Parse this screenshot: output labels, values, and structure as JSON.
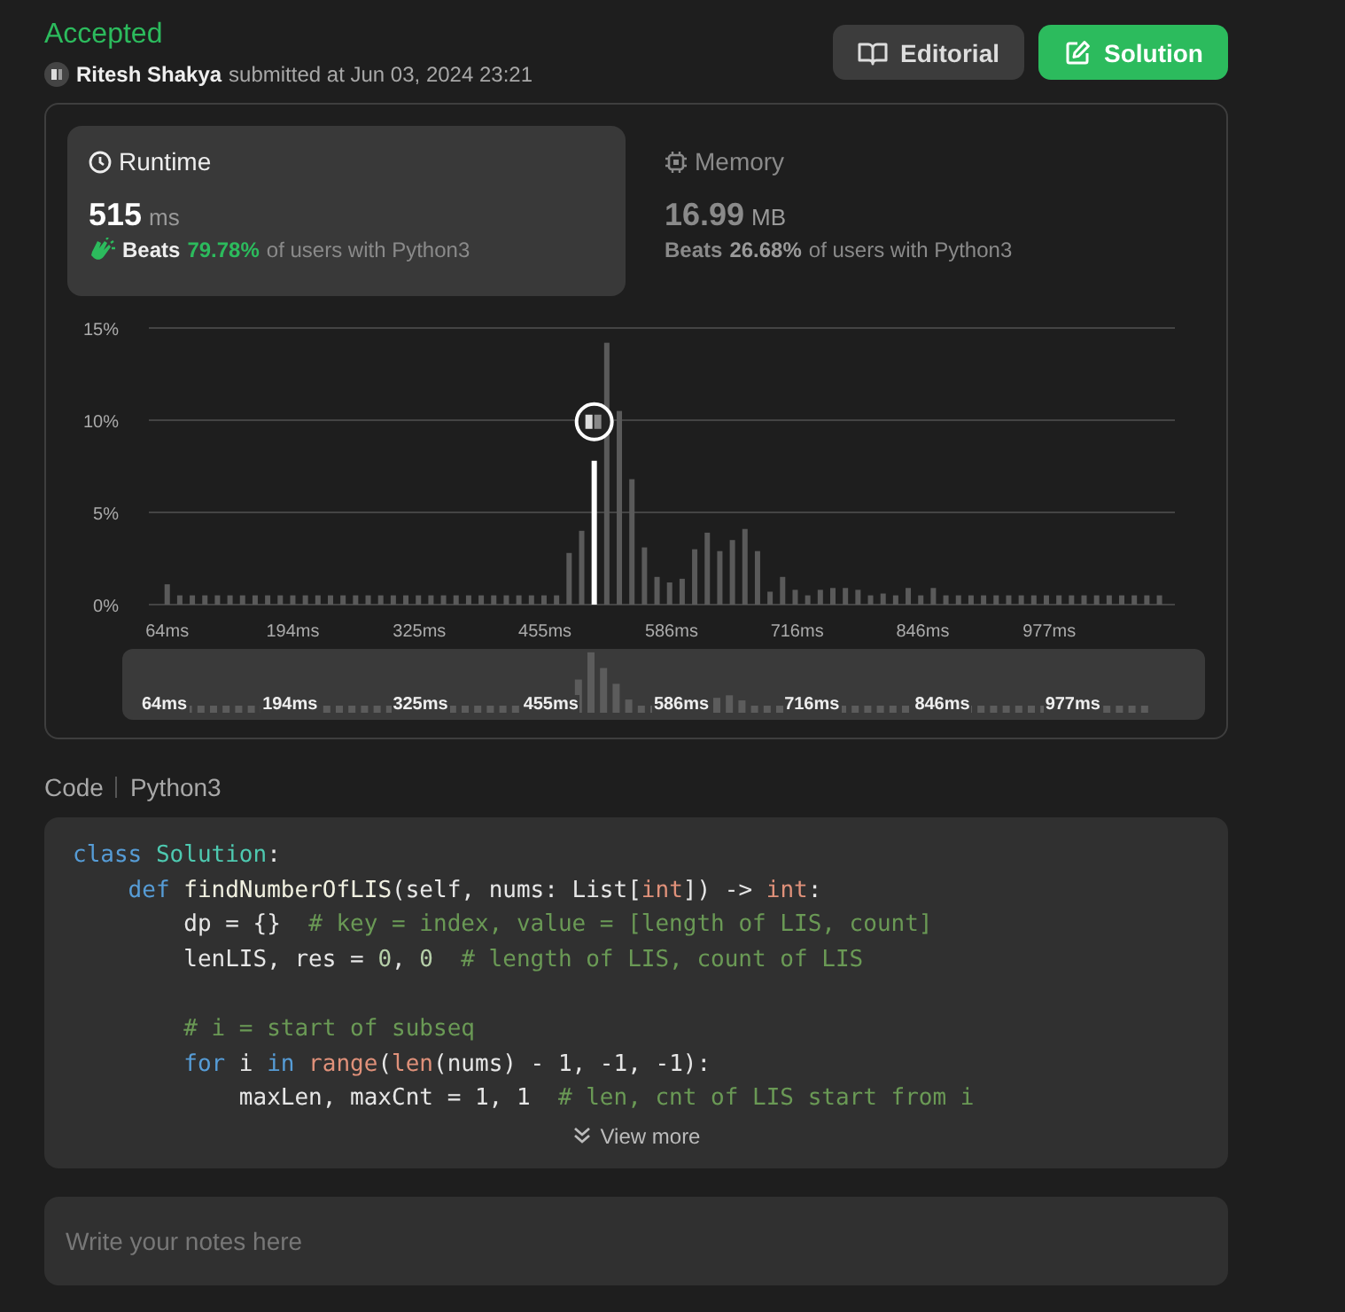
{
  "header": {
    "status": "Accepted",
    "user": "Ritesh Shakya",
    "submitted": "submitted at Jun 03, 2024 23:21"
  },
  "buttons": [
    {
      "label": "Editorial",
      "kind": "secondary"
    },
    {
      "label": "Solution",
      "kind": "primary"
    }
  ],
  "metrics": [
    {
      "label": "Runtime",
      "kind": "time",
      "value": "515",
      "unit": "ms",
      "beats": "Beats",
      "percent": "79.78%",
      "rest": "of users with Python3",
      "selected": true
    },
    {
      "label": "Memory",
      "kind": "memory",
      "value": "16.99",
      "unit": "MB",
      "beats": "Beats",
      "percent": "26.68%",
      "rest": "of users with Python3",
      "selected": false
    }
  ],
  "chart": {
    "chart_data": {
      "type": "bar",
      "stacked": true,
      "xlim": [
        45,
        1107
      ],
      "ylim": [
        0,
        15
      ],
      "yticks": [
        {
          "value": 0,
          "label": "0%"
        },
        {
          "value": 5,
          "label": "5%"
        },
        {
          "value": 10,
          "label": "10%"
        },
        {
          "value": 15,
          "label": "15%"
        }
      ],
      "xticks": [
        {
          "value": 64,
          "label": "64ms"
        },
        {
          "value": 194,
          "label": "194ms"
        },
        {
          "value": 325,
          "label": "325ms"
        },
        {
          "value": 455,
          "label": "455ms"
        },
        {
          "value": 586,
          "label": "586ms"
        },
        {
          "value": 716,
          "label": "716ms"
        },
        {
          "value": 846,
          "label": "846ms"
        },
        {
          "value": 977,
          "label": "977ms"
        }
      ],
      "x": [
        64,
        77,
        90,
        103,
        116,
        129,
        142,
        155,
        168,
        181,
        194,
        207,
        220,
        233,
        246,
        259,
        272,
        285,
        298,
        311,
        324,
        337,
        350,
        363,
        376,
        389,
        402,
        415,
        428,
        441,
        454,
        467,
        480,
        493,
        506,
        519,
        532,
        545,
        558,
        571,
        584,
        597,
        610,
        623,
        636,
        649,
        662,
        675,
        688,
        701,
        714,
        727,
        740,
        753,
        766,
        779,
        792,
        805,
        818,
        831,
        844,
        857,
        870,
        883,
        896,
        909,
        922,
        935,
        948,
        961,
        974,
        987,
        1000,
        1013,
        1026,
        1039,
        1052,
        1065,
        1078,
        1091
      ],
      "series": [
        {
          "color": "#5a5a5a",
          "values": [
            1.1,
            0.5,
            0.5,
            0.5,
            0.5,
            0.5,
            0.5,
            0.5,
            0.5,
            0.5,
            0.5,
            0.5,
            0.5,
            0.5,
            0.5,
            0.5,
            0.5,
            0.5,
            0.5,
            0.5,
            0.5,
            0.5,
            0.5,
            0.5,
            0.5,
            0.5,
            0.5,
            0.5,
            0.5,
            0.5,
            0.5,
            0.5,
            2.8,
            4.0,
            null,
            14.2,
            10.5,
            6.8,
            3.1,
            1.5,
            1.2,
            1.4,
            3.0,
            3.9,
            2.9,
            3.5,
            4.1,
            2.9,
            0.7,
            1.5,
            0.8,
            0.5,
            0.8,
            0.9,
            0.9,
            0.8,
            0.5,
            0.6,
            0.5,
            0.9,
            0.5,
            0.9,
            0.5,
            0.5,
            0.5,
            0.5,
            0.5,
            0.5,
            0.5,
            0.5,
            0.5,
            0.5,
            0.5,
            0.5,
            0.5,
            0.5,
            0.5,
            0.5,
            0.5,
            0.5
          ]
        },
        {
          "color": "#ffffff",
          "values": [
            null,
            null,
            null,
            null,
            null,
            null,
            null,
            null,
            null,
            null,
            null,
            null,
            null,
            null,
            null,
            null,
            null,
            null,
            null,
            null,
            null,
            null,
            null,
            null,
            null,
            null,
            null,
            null,
            null,
            null,
            null,
            null,
            null,
            null,
            7.8,
            null,
            null,
            null,
            null,
            null,
            null,
            null,
            null,
            null,
            null,
            null,
            null,
            null,
            null,
            null,
            null,
            null,
            null,
            null,
            null,
            null,
            null,
            null,
            null,
            null,
            null,
            null,
            null,
            null,
            null,
            null,
            null,
            null,
            null,
            null,
            null,
            null,
            null,
            null,
            null,
            null,
            null,
            null,
            null,
            null
          ]
        }
      ]
    },
    "navigator": {
      "labels": [
        "64ms",
        "194ms",
        "325ms",
        "455ms",
        "586ms",
        "716ms",
        "846ms",
        "977ms"
      ]
    }
  },
  "code": {
    "title": "Code",
    "language": "Python3",
    "lines": [
      {
        "kind": "code",
        "tokens": [
          {
            "kind": "keyword",
            "text": "class"
          },
          {
            "kind": "type",
            "text": " Solution"
          },
          {
            "kind": "plain",
            "text": ":"
          }
        ]
      },
      {
        "kind": "code",
        "tokens": [
          {
            "kind": "keyword",
            "text": "    def"
          },
          {
            "kind": "function",
            "text": " findNumberOfLIS"
          },
          {
            "kind": "plain",
            "text": "(self, nums: List["
          },
          {
            "kind": "builtin",
            "text": "int"
          },
          {
            "kind": "plain",
            "text": "]) -> "
          },
          {
            "kind": "builtin",
            "text": "int"
          },
          {
            "kind": "plain",
            "text": ":"
          }
        ]
      },
      {
        "kind": "code",
        "tokens": [
          {
            "kind": "plain",
            "text": "        dp = {}  "
          },
          {
            "kind": "comment",
            "text": "# key = index, value = [length of LIS, count]"
          }
        ]
      },
      {
        "kind": "code",
        "tokens": [
          {
            "kind": "plain",
            "text": "        lenLIS, res = "
          },
          {
            "kind": "number",
            "text": "0"
          },
          {
            "kind": "plain",
            "text": ", "
          },
          {
            "kind": "number",
            "text": "0"
          },
          {
            "kind": "comment",
            "text": "  # length of LIS, count of LIS"
          }
        ]
      },
      {
        "kind": "blank"
      },
      {
        "kind": "code",
        "tokens": [
          {
            "kind": "comment",
            "text": "        # i = start of subseq"
          }
        ]
      },
      {
        "kind": "code",
        "tokens": [
          {
            "kind": "keyword",
            "text": "        for"
          },
          {
            "kind": "plain",
            "text": " i "
          },
          {
            "kind": "keyword",
            "text": "in"
          },
          {
            "kind": "builtin",
            "text": " range"
          },
          {
            "kind": "plain",
            "text": "("
          },
          {
            "kind": "builtin",
            "text": "len"
          },
          {
            "kind": "plain",
            "text": "(nums) - 1, -1, -1):"
          }
        ]
      },
      {
        "kind": "code",
        "tokens": [
          {
            "kind": "plain",
            "text": "            maxLen, maxCnt = 1, 1  "
          },
          {
            "kind": "comment",
            "text": "# len, cnt of LIS start from i"
          }
        ]
      }
    ],
    "more": "View more"
  },
  "notes": {
    "placeholder": "Write your notes here"
  }
}
